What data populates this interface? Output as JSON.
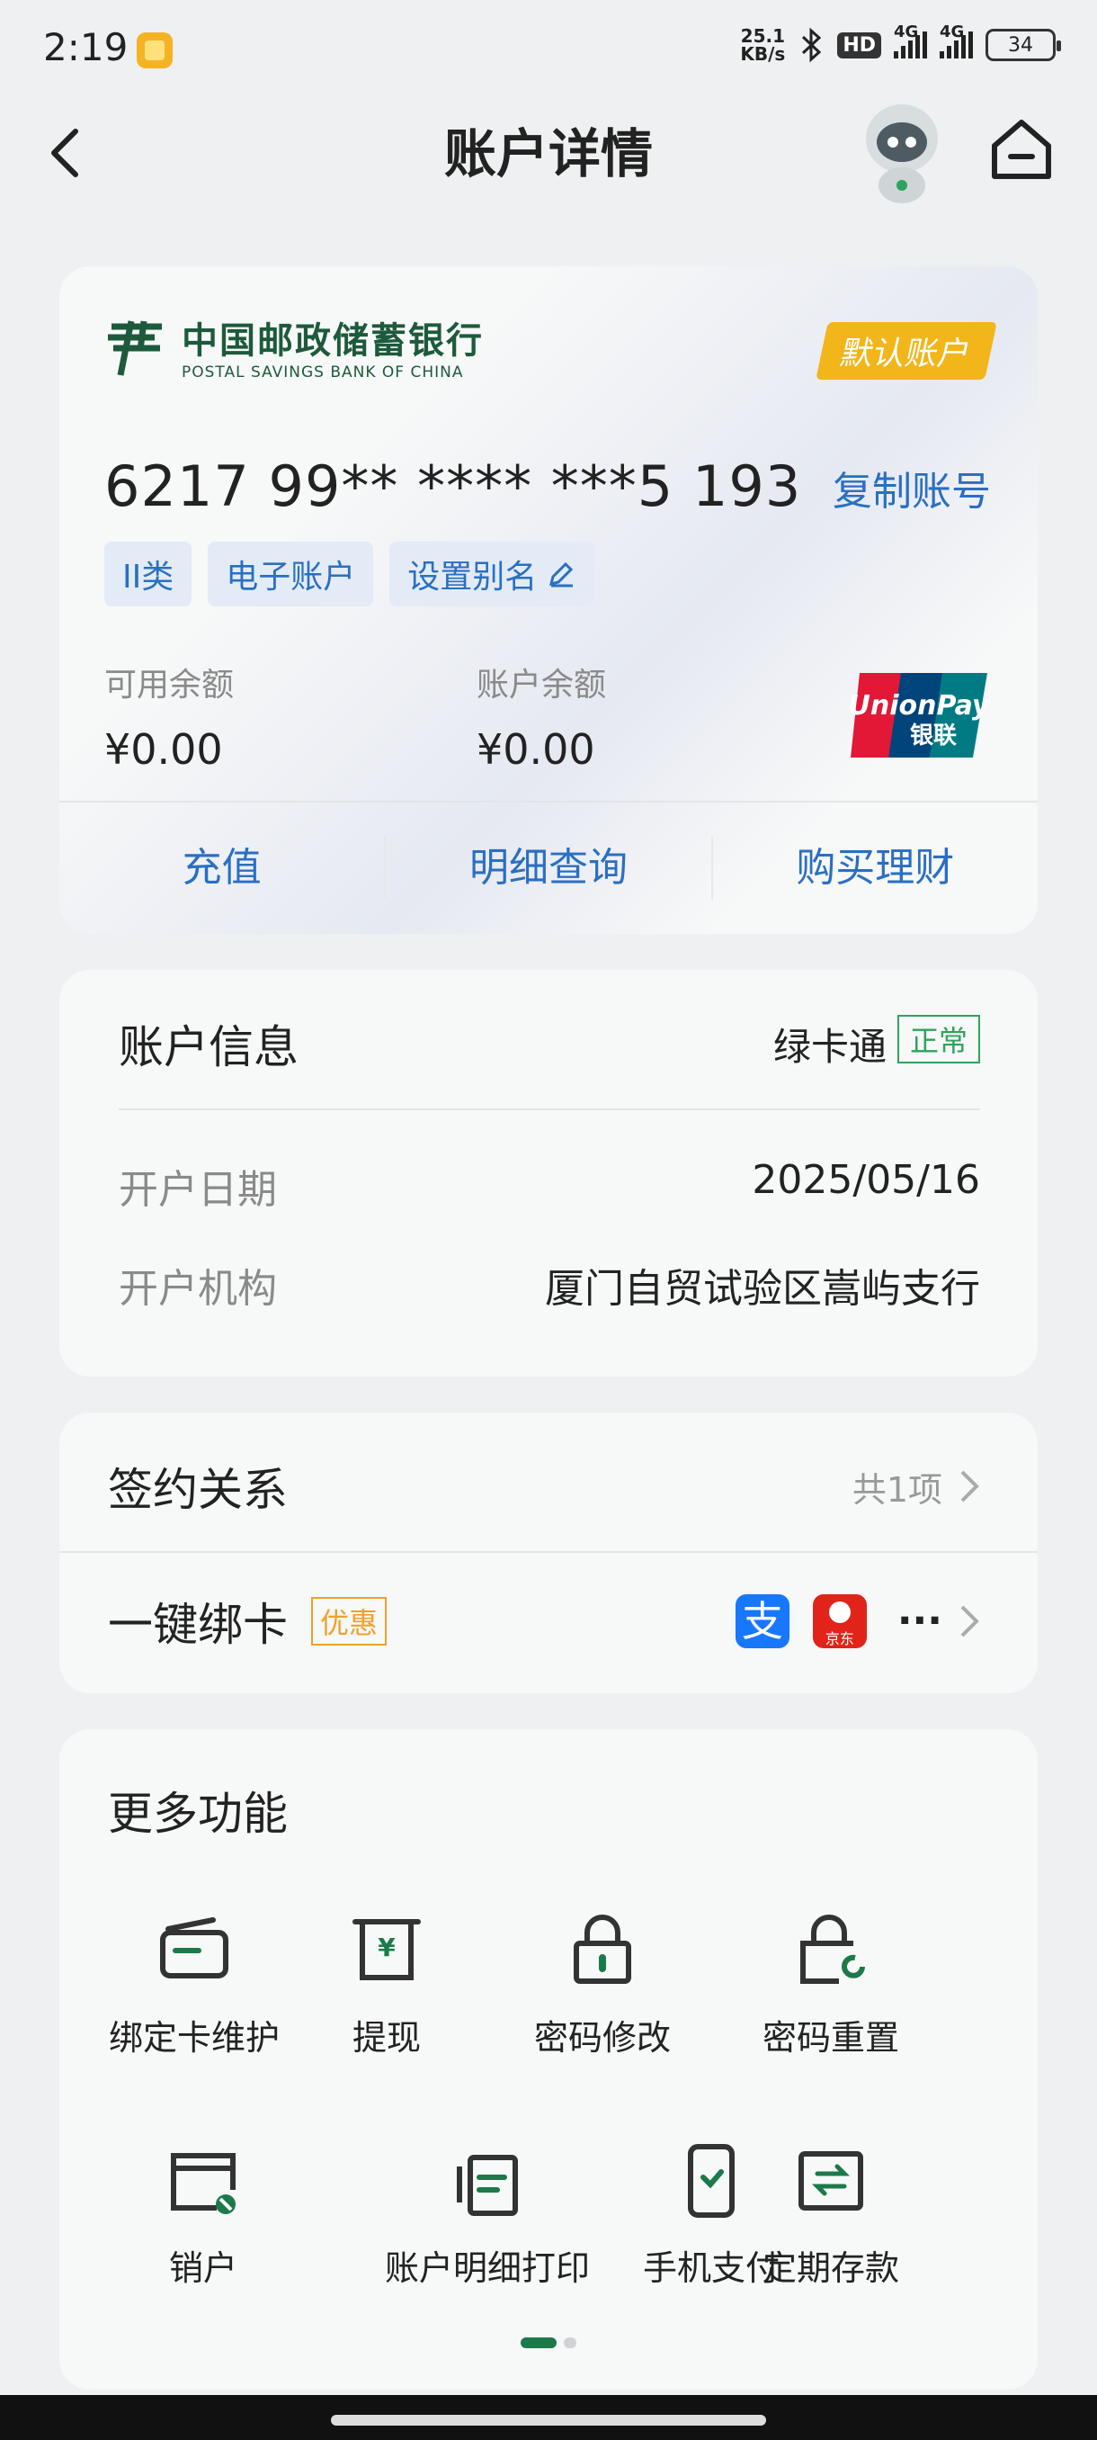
{
  "status_bar": {
    "time": "2:19",
    "net_speed_top": "25.1",
    "net_speed_bottom": "KB/s",
    "hd": "HD",
    "sig1": "4G",
    "sig2": "4G",
    "battery": "34"
  },
  "header": {
    "title": "账户详情",
    "back_icon": "chevron-left-icon",
    "home_icon": "home-icon",
    "assistant_icon": "robot-avatar-icon"
  },
  "card": {
    "bank_name_cn": "中国邮政储蓄银行",
    "bank_name_en": "POSTAL SAVINGS BANK OF CHINA",
    "default_badge": "默认账户",
    "account_number": "6217 99** **** ***5 193",
    "copy_label": "复制账号",
    "tags": [
      "II类",
      "电子账户",
      "设置别名"
    ],
    "available_label": "可用余额",
    "available_value": "¥0.00",
    "balance_label": "账户余额",
    "balance_value": "¥0.00",
    "unionpay_en": "UnionPay",
    "unionpay_cn": "银联",
    "actions": [
      "充值",
      "明细查询",
      "购买理财"
    ]
  },
  "account_info": {
    "title": "账户信息",
    "card_type": "绿卡通",
    "status": "正常",
    "rows": [
      {
        "label": "开户日期",
        "value": "2025/05/16"
      },
      {
        "label": "开户机构",
        "value": "厦门自贸试验区嵩屿支行"
      }
    ]
  },
  "relations": {
    "signing_title": "签约关系",
    "signing_count": "共1项",
    "bind_title": "一键绑卡",
    "bind_badge": "优惠",
    "alipay_glyph": "支",
    "jd_label": "京东",
    "more_dots": "···"
  },
  "more_functions": {
    "title": "更多功能",
    "items": [
      {
        "label": "绑定卡维护",
        "icon": "card-icon"
      },
      {
        "label": "提现",
        "icon": "withdraw-icon"
      },
      {
        "label": "密码修改",
        "icon": "lock-icon"
      },
      {
        "label": "密码重置",
        "icon": "lock-reset-icon"
      },
      {
        "label": "销户",
        "icon": "card-cancel-icon"
      },
      {
        "label": "账户明细打印",
        "icon": "print-doc-icon"
      },
      {
        "label": "手机支付",
        "icon": "phone-pay-icon"
      },
      {
        "label": "定期存款",
        "icon": "deposit-icon"
      }
    ]
  },
  "colors": {
    "accent_blue": "#2a6fc2",
    "brand_green": "#1d5a3b",
    "status_green": "#2ea35e",
    "badge_yellow": "#f2b51a",
    "promo_orange": "#f0a12a"
  }
}
